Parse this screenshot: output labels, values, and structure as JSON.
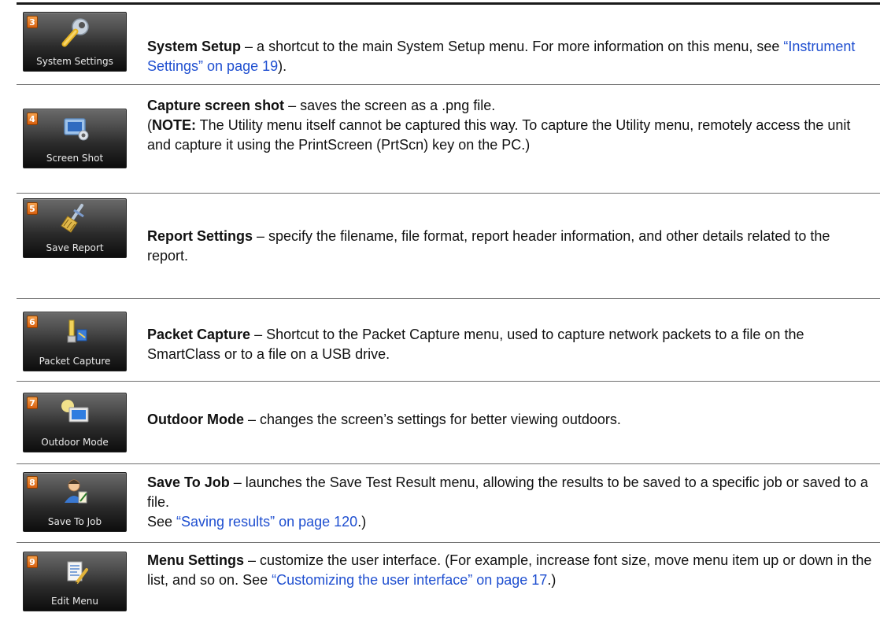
{
  "rows": [
    {
      "badge": "3",
      "button_label": "System Settings",
      "icon": "wrench-icon",
      "title": "System Setup",
      "text": " – a shortcut to the main System Setup menu. For more information on this menu, see ",
      "link": "“Instrument Settings” on page 19",
      "tail": ")."
    },
    {
      "badge": "4",
      "button_label": "Screen Shot",
      "icon": "screen-shot-icon",
      "title": "Capture screen shot",
      "text": " – saves the screen as a  .png file.",
      "note_open": "(",
      "note_label": "NOTE:",
      "note_text": " The Utility menu itself cannot be captured this way. To capture the Utility menu, remotely access the unit and capture it using the PrintScreen (PrtScn) key on the PC.)"
    },
    {
      "badge": "5",
      "button_label": "Save Report",
      "icon": "broom-icon",
      "title": "Report Settings",
      "text": " – specify the filename, file format, report header information, and other details related to the report."
    },
    {
      "badge": "6",
      "button_label": "Packet Capture",
      "icon": "packet-capture-icon",
      "title": "Packet Capture",
      "text": " – Shortcut to the Packet Capture menu, used to capture network packets to a file on the SmartClass or to a file on a USB drive."
    },
    {
      "badge": "7",
      "button_label": "Outdoor Mode",
      "icon": "outdoor-monitor-icon",
      "title": "Outdoor Mode",
      "text": " – changes the screen’s settings for better viewing outdoors."
    },
    {
      "badge": "8",
      "button_label": "Save To Job",
      "icon": "user-save-icon",
      "title": "Save To Job",
      "text": " – launches the Save Test Result menu, allowing the results to be saved to a specific job or saved to a file.",
      "see": "See ",
      "link": "“Saving results” on page 120",
      "tail": ".)"
    },
    {
      "badge": "9",
      "button_label": "Edit Menu",
      "icon": "edit-menu-icon",
      "title": "Menu Settings",
      "text": " – customize the user interface. (For example, increase font size, move menu item up or down in the list, and so on. See ",
      "link": "“Customizing the user interface” on page 17",
      "tail": ".)"
    }
  ]
}
